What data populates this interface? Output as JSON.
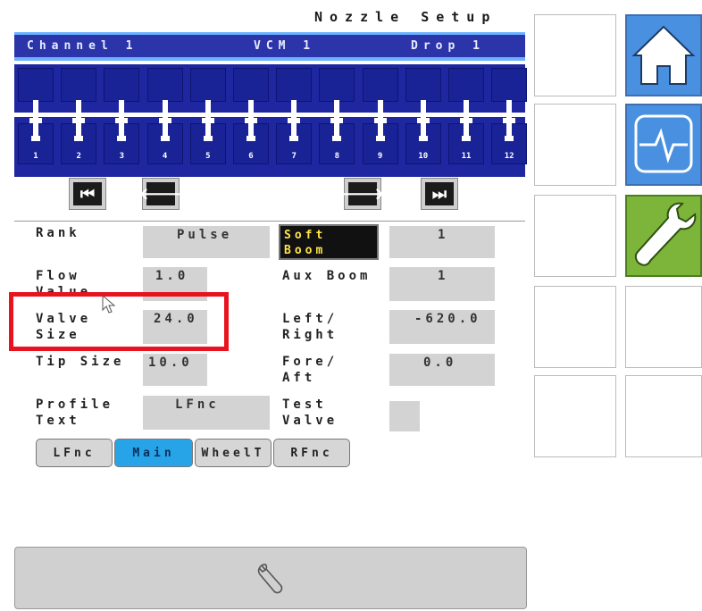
{
  "header": {
    "title": "Nozzle Setup"
  },
  "channel_bar": {
    "channel": "Channel 1",
    "vcm": "VCM 1",
    "drop": "Drop 1"
  },
  "nozzles": {
    "numbers": [
      "1",
      "2",
      "3",
      "4",
      "5",
      "6",
      "7",
      "8",
      "9",
      "10",
      "11",
      "12"
    ],
    "selected": "1"
  },
  "nav": {
    "first_icon": "skip-first-icon",
    "prev_icon": "arrow-left-icon",
    "next_icon": "arrow-right-icon",
    "last_icon": "skip-last-icon"
  },
  "form": {
    "rank_label": "Rank",
    "rank_value": "Pulse",
    "boom_toggle": "Soft Boom",
    "boom_value": "1",
    "flow_label": "Flow Value",
    "flow_value": "1.0",
    "aux_label": "Aux Boom",
    "aux_value": "1",
    "valve_label": "Valve Size",
    "valve_value": "24.0",
    "leftright_label": "Left/ Right",
    "leftright_value": "-620.0",
    "tip_label": "Tip Size",
    "tip_value": "10.0",
    "foreaft_label": "Fore/ Aft",
    "foreaft_value": "0.0",
    "profile_label": "Profile Text",
    "profile_value": "LFnc",
    "test_label": "Test Valve"
  },
  "tabs": [
    {
      "label": "LFnc",
      "active": false
    },
    {
      "label": "Main",
      "active": true
    },
    {
      "label": "WheelT",
      "active": false
    },
    {
      "label": "RFnc",
      "active": false
    }
  ],
  "sidebar": {
    "home_icon": "home-icon",
    "diagnostics_icon": "pulse-icon",
    "settings_icon": "wrench-icon"
  },
  "colors": {
    "panel": "#1e27a0",
    "accent": "#27a4e8",
    "highlight": "#e8131e",
    "wrench_bg": "#7cb53a",
    "home_bg": "#4a90e0"
  }
}
